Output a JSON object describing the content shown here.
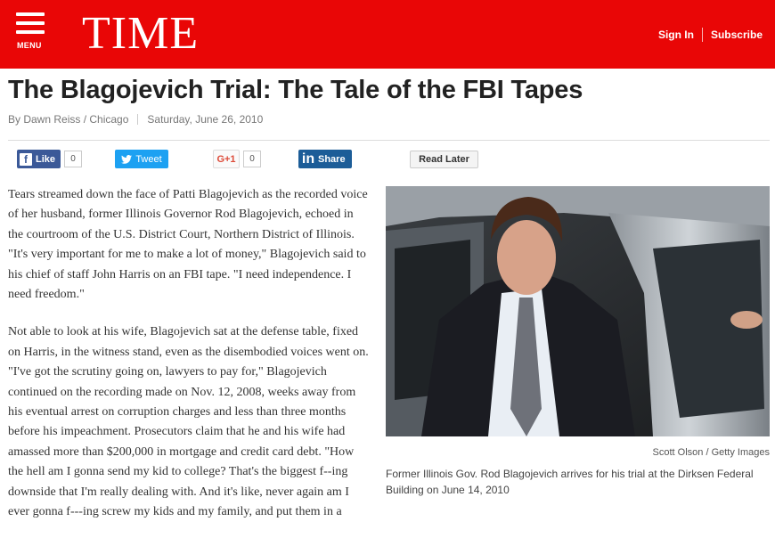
{
  "header": {
    "menu_label": "MENU",
    "logo": "TIME",
    "sign_in": "Sign In",
    "subscribe": "Subscribe",
    "brand_color": "#e90606"
  },
  "article": {
    "title": "The Blagojevich Trial: The Tale of the FBI Tapes",
    "byline": "By Dawn Reiss / Chicago",
    "date": "Saturday, June 26, 2010",
    "paragraphs": [
      "Tears streamed down the face of Patti Blagojevich as the recorded voice of her husband, former Illinois Governor Rod Blagojevich, echoed in the courtroom of the U.S. District Court, Northern District of Illinois. \"It's very important for me to make a lot of money,\" Blagojevich said to his chief of staff John Harris on an FBI tape. \"I need independence. I need freedom.\"",
      "Not able to look at his wife, Blagojevich sat at the defense table, fixed on Harris, in the witness stand, even as the disembodied voices went on. \"I've got the scrutiny going on, lawyers to pay for,\" Blagojevich continued on the recording made on Nov. 12, 2008, weeks away from his eventual arrest on corruption charges and less than three months before his impeachment. Prosecutors claim that he and his wife had amassed more than $200,000 in mortgage and credit card debt. \"How the hell am I gonna send my kid to college? That's the biggest f--ing downside that I'm really dealing with. And it's like, never again am I ever gonna f---ing screw my kids and my family, and put them in a"
    ]
  },
  "share": {
    "facebook_label": "Like",
    "facebook_icon": "f",
    "facebook_count": "0",
    "twitter_label": "Tweet",
    "googleplus_label": "G+1",
    "googleplus_count": "0",
    "linkedin_icon": "in",
    "linkedin_label": "Share",
    "read_later": "Read Later"
  },
  "photo": {
    "credit": "Scott Olson / Getty Images",
    "caption": "Former Illinois Gov. Rod Blagojevich arrives for his trial at the Dirksen Federal Building on June 14, 2010"
  }
}
